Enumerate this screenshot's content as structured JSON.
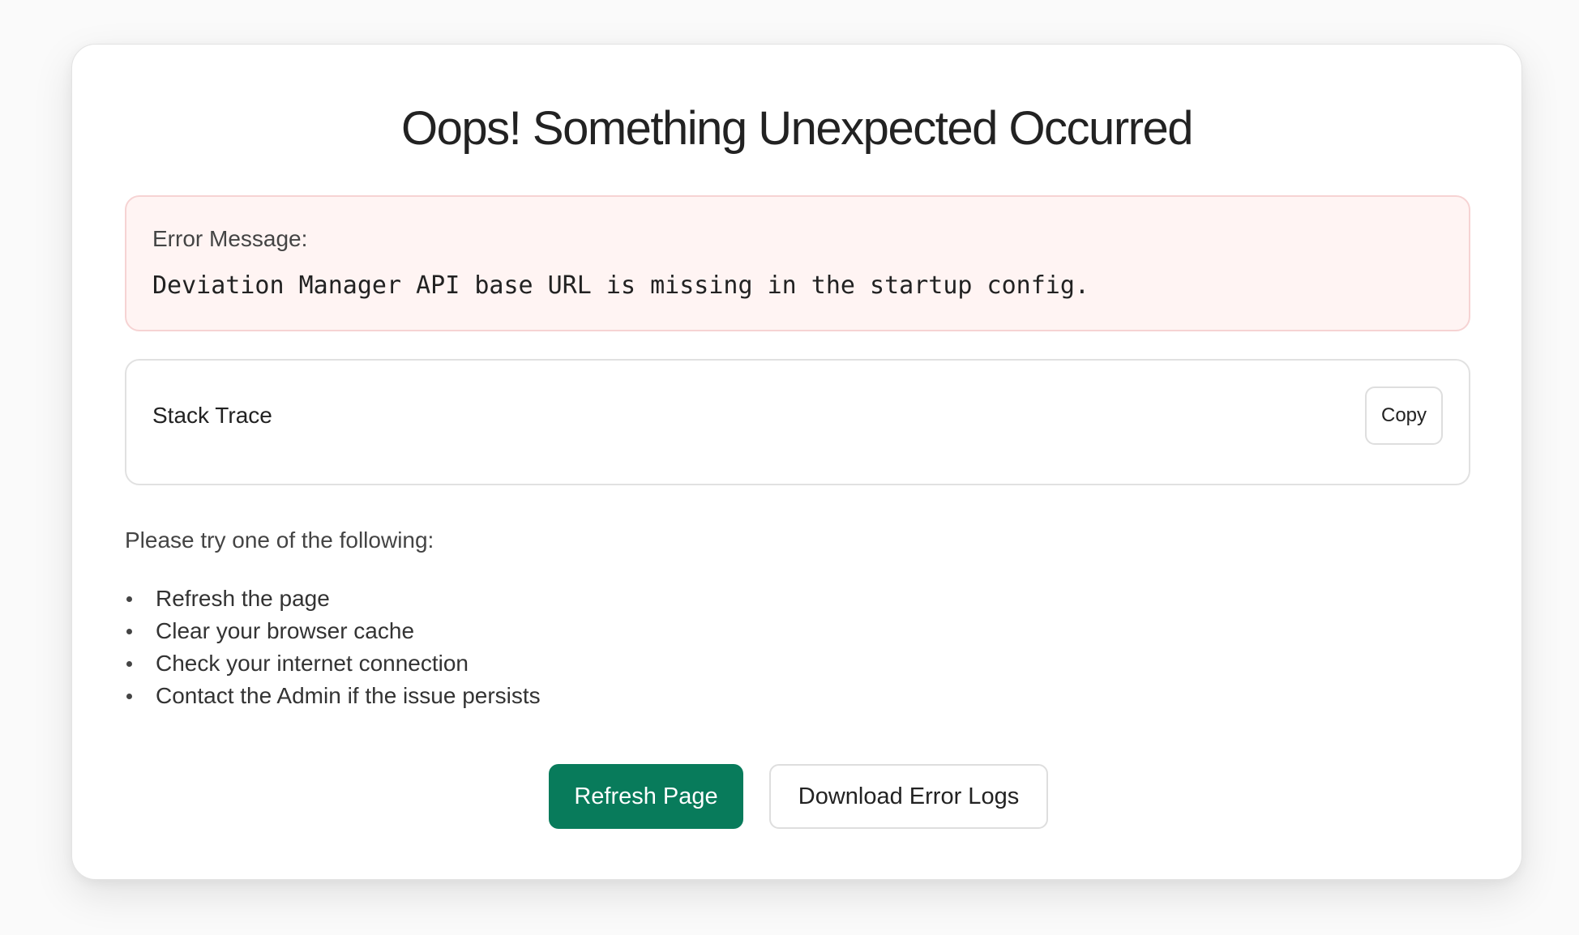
{
  "page": {
    "title": "Oops! Something Unexpected Occurred"
  },
  "error": {
    "label": "Error Message:",
    "message": "Deviation Manager API base URL is missing in the startup config."
  },
  "stack_trace": {
    "title": "Stack Trace",
    "copy_label": "Copy"
  },
  "suggestions": {
    "intro": "Please try one of the following:",
    "items": [
      "Refresh the page",
      "Clear your browser cache",
      "Check your internet connection",
      "Contact the Admin if the issue persists"
    ]
  },
  "actions": {
    "refresh_label": "Refresh Page",
    "download_label": "Download Error Logs"
  },
  "colors": {
    "primary": "#087b5b",
    "error_background": "#fff4f3",
    "error_border": "#f6d3d3"
  }
}
